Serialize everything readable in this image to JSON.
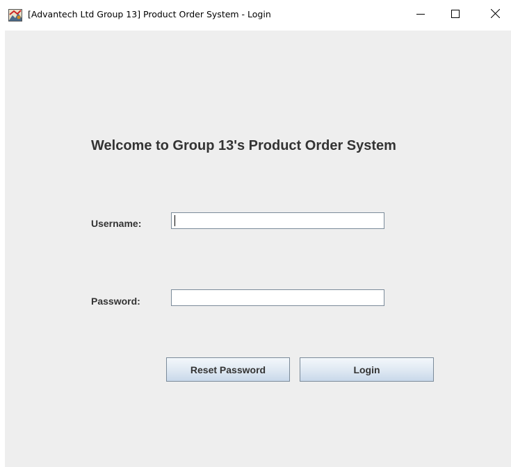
{
  "window": {
    "title": "[Advantech Ltd Group 13] Product Order System - Login",
    "icons": {
      "app": "java-app-icon",
      "minimize": "minimize-icon",
      "maximize": "maximize-icon",
      "close": "close-icon"
    }
  },
  "login": {
    "welcome": "Welcome to Group 13's Product Order System",
    "username_label": "Username:",
    "username_value": "",
    "password_label": "Password:",
    "password_value": "",
    "reset_label": "Reset Password",
    "login_label": "Login"
  },
  "colors": {
    "panel_bg": "#eeeeee",
    "text": "#333333",
    "input_border": "#7a8a99"
  }
}
